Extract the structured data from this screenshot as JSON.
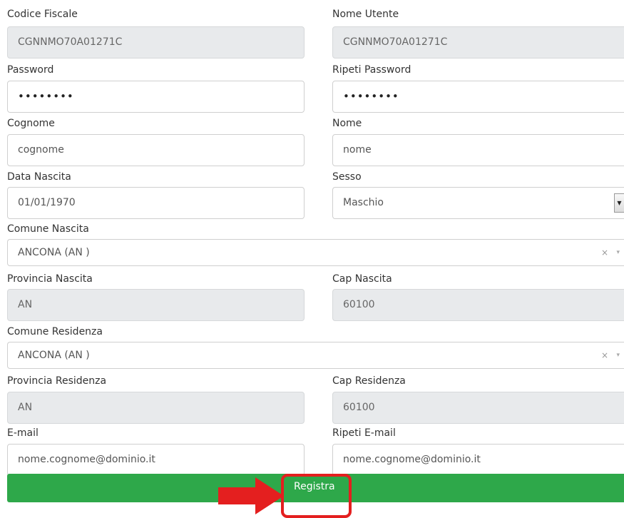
{
  "form": {
    "codice_fiscale": {
      "label": "Codice Fiscale",
      "value": "CGNNMO70A01271C"
    },
    "nome_utente": {
      "label": "Nome Utente",
      "value": "CGNNMO70A01271C"
    },
    "password": {
      "label": "Password",
      "value": "••••••••"
    },
    "ripeti_password": {
      "label": "Ripeti Password",
      "value": "••••••••"
    },
    "cognome": {
      "label": "Cognome",
      "value": "cognome"
    },
    "nome": {
      "label": "Nome",
      "value": "nome"
    },
    "data_nascita": {
      "label": "Data Nascita",
      "value": "01/01/1970"
    },
    "sesso": {
      "label": "Sesso",
      "value": "Maschio",
      "arrow_icon": "caret-down-icon"
    },
    "comune_nascita": {
      "label": "Comune Nascita",
      "value": "ANCONA (AN )",
      "clear_symbol": "×",
      "arrow_symbol": "▾"
    },
    "provincia_nascita": {
      "label": "Provincia Nascita",
      "value": "AN"
    },
    "cap_nascita": {
      "label": "Cap Nascita",
      "value": "60100"
    },
    "comune_residenza": {
      "label": "Comune Residenza",
      "value": "ANCONA (AN )",
      "clear_symbol": "×",
      "arrow_symbol": "▾"
    },
    "provincia_residenza": {
      "label": "Provincia Residenza",
      "value": "AN"
    },
    "cap_residenza": {
      "label": "Cap Residenza",
      "value": "60100"
    },
    "email": {
      "label": "E-mail",
      "value": "nome.cognome@dominio.it"
    },
    "ripeti_email": {
      "label": "Ripeti E-mail",
      "value": "nome.cognome@dominio.it"
    },
    "submit_label": "Registra"
  },
  "colors": {
    "submit_bg": "#2ea84a",
    "readonly_bg": "#e8eaec",
    "annotation_red": "#e41f1f"
  }
}
